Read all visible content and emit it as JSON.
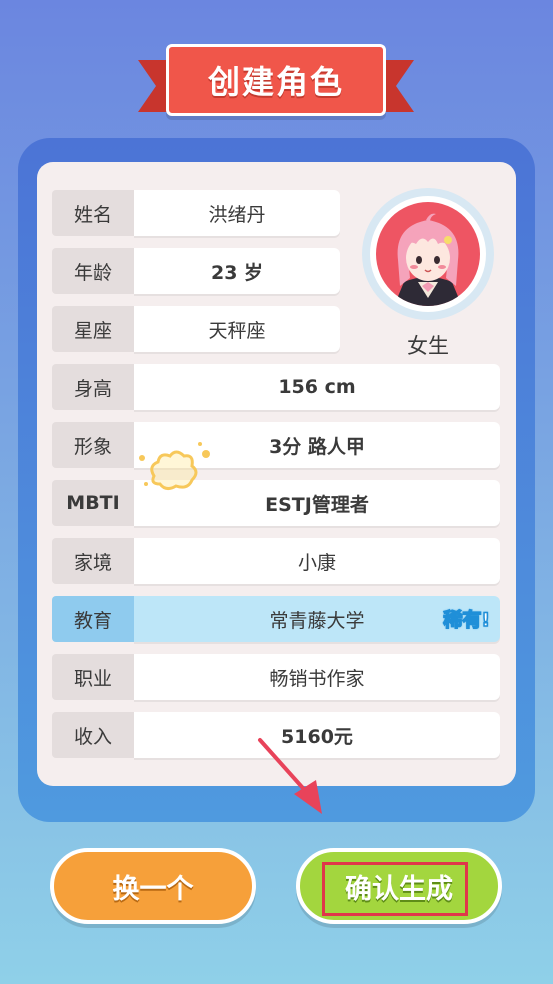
{
  "header": {
    "title": "创建角色"
  },
  "rows": [
    {
      "label": "姓名",
      "value": "洪绪丹"
    },
    {
      "label": "年龄",
      "value": "23 岁"
    },
    {
      "label": "星座",
      "value": "天秤座"
    },
    {
      "label": "身高",
      "value": "156 cm"
    },
    {
      "label": "形象",
      "value": "3分 路人甲"
    },
    {
      "label": "MBTI",
      "value": "ESTJ管理者"
    },
    {
      "label": "家境",
      "value": "小康"
    },
    {
      "label": "教育",
      "value": "常青藤大学",
      "badge": "稀有!"
    },
    {
      "label": "职业",
      "value": "畅销书作家"
    },
    {
      "label": "收入",
      "value": "5160元"
    }
  ],
  "avatar": {
    "gender": "女生"
  },
  "buttons": {
    "swap": "换一个",
    "confirm": "确认生成"
  },
  "colors": {
    "banner": "#f0564a",
    "highlight_row": "#bde6f8",
    "rare_badge": "#1f8fd8",
    "swap_button": "#f6a03a",
    "confirm_button": "#a3d63e",
    "annotation": "#e0364a"
  }
}
